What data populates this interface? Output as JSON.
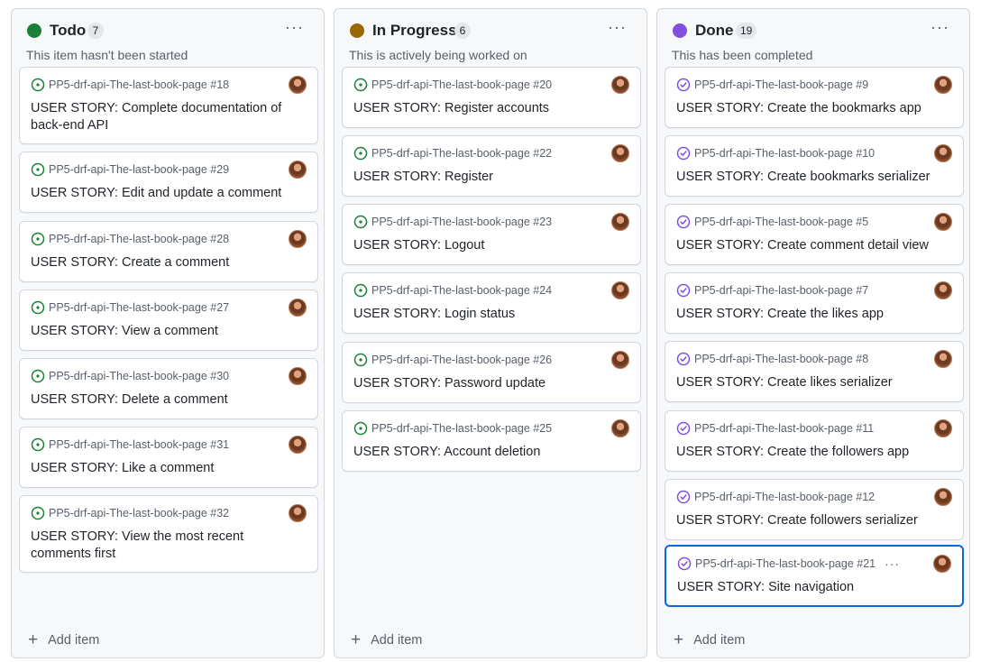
{
  "columns": [
    {
      "title": "Todo",
      "count": "7",
      "color": "#1a7f37",
      "description": "This item hasn't been started",
      "menu_label": "···",
      "add_label": "Add item",
      "card_icon": "issue-open-icon",
      "cards": [
        {
          "repo": "PP5-drf-api-The-last-book-page #18",
          "title": "USER STORY: Complete documentation of back-end API"
        },
        {
          "repo": "PP5-drf-api-The-last-book-page #29",
          "title": "USER STORY: Edit and update a comment"
        },
        {
          "repo": "PP5-drf-api-The-last-book-page #28",
          "title": "USER STORY: Create a comment"
        },
        {
          "repo": "PP5-drf-api-The-last-book-page #27",
          "title": "USER STORY: View a comment"
        },
        {
          "repo": "PP5-drf-api-The-last-book-page #30",
          "title": "USER STORY: Delete a comment"
        },
        {
          "repo": "PP5-drf-api-The-last-book-page #31",
          "title": "USER STORY: Like a comment"
        },
        {
          "repo": "PP5-drf-api-The-last-book-page #32",
          "title": "USER STORY: View the most recent comments first"
        }
      ]
    },
    {
      "title": "In Progress",
      "count": "6",
      "color": "#9a6700",
      "description": "This is actively being worked on",
      "menu_label": "···",
      "add_label": "Add item",
      "card_icon": "issue-open-icon",
      "cards": [
        {
          "repo": "PP5-drf-api-The-last-book-page #20",
          "title": "USER STORY: Register accounts"
        },
        {
          "repo": "PP5-drf-api-The-last-book-page #22",
          "title": "USER STORY: Register"
        },
        {
          "repo": "PP5-drf-api-The-last-book-page #23",
          "title": "USER STORY: Logout"
        },
        {
          "repo": "PP5-drf-api-The-last-book-page #24",
          "title": "USER STORY: Login status"
        },
        {
          "repo": "PP5-drf-api-The-last-book-page #26",
          "title": "USER STORY: Password update"
        },
        {
          "repo": "PP5-drf-api-The-last-book-page #25",
          "title": "USER STORY: Account deletion"
        }
      ]
    },
    {
      "title": "Done",
      "count": "19",
      "color": "#8250df",
      "description": "This has been completed",
      "menu_label": "···",
      "add_label": "Add item",
      "card_icon": "issue-closed-icon",
      "cards": [
        {
          "repo": "PP5-drf-api-The-last-book-page #9",
          "title": "USER STORY: Create the bookmarks app"
        },
        {
          "repo": "PP5-drf-api-The-last-book-page #10",
          "title": "USER STORY: Create bookmarks serializer"
        },
        {
          "repo": "PP5-drf-api-The-last-book-page #5",
          "title": "USER STORY: Create comment detail view"
        },
        {
          "repo": "PP5-drf-api-The-last-book-page #7",
          "title": "USER STORY: Create the likes app"
        },
        {
          "repo": "PP5-drf-api-The-last-book-page #8",
          "title": "USER STORY: Create likes serializer"
        },
        {
          "repo": "PP5-drf-api-The-last-book-page #11",
          "title": "USER STORY: Create the followers app"
        },
        {
          "repo": "PP5-drf-api-The-last-book-page #12",
          "title": "USER STORY: Create followers serializer"
        },
        {
          "repo": "PP5-drf-api-The-last-book-page #21",
          "title": "USER STORY: Site navigation",
          "selected": true,
          "more_label": "···"
        }
      ]
    }
  ],
  "icon_colors": {
    "issue-open-icon": "#1a7f37",
    "issue-closed-icon": "#8250df"
  }
}
